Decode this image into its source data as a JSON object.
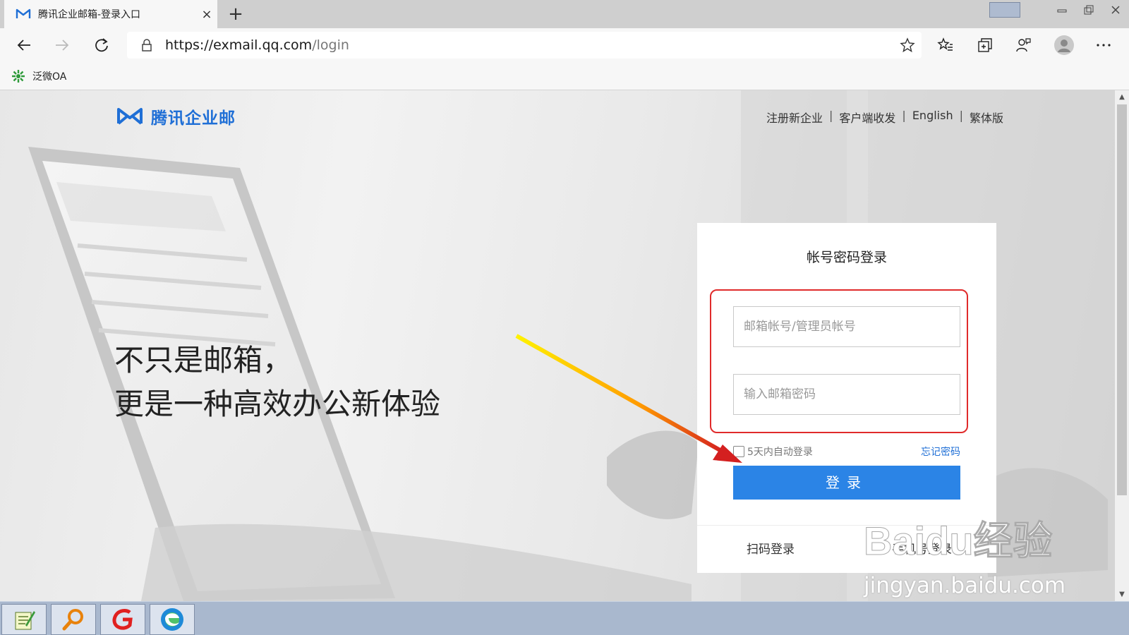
{
  "browser": {
    "tab_title": "腾讯企业邮箱-登录入口",
    "new_tab_label": "+",
    "close_tab_label": "×",
    "url_host": "https://exmail.qq.com",
    "url_path": "/login",
    "bookmark": "泛微OA"
  },
  "page": {
    "brand": "腾讯企业邮",
    "nav": [
      "注册新企业",
      "客户端收发",
      "English",
      "繁体版"
    ],
    "nav_separator": "|",
    "slogan_line1": "不只是邮箱，",
    "slogan_line2": "更是一种高效办公新体验"
  },
  "login": {
    "title": "帐号密码登录",
    "account_placeholder": "邮箱帐号/管理员帐号",
    "password_placeholder": "输入邮箱密码",
    "remember_label": "5天内自动登录",
    "forgot_label": "忘记密码",
    "submit_label": "登录",
    "qr_login": "扫码登录",
    "phone_login": "手机号登录"
  },
  "watermark": {
    "brand": "Baidu经验",
    "url": "jingyan.baidu.com"
  },
  "colors": {
    "accent": "#2b84e6",
    "brand_blue": "#1f6fd6",
    "highlight_red": "#e02b2b",
    "arrow_yellow": "#ffe600",
    "arrow_red": "#d42020"
  },
  "icons": {
    "back": "arrow-left-icon",
    "forward": "arrow-right-icon",
    "refresh": "refresh-icon",
    "lock": "lock-icon",
    "favorite": "star-icon",
    "favorites": "favorites-icon",
    "collections": "collections-icon",
    "feedback": "feedback-icon",
    "profile": "profile-icon",
    "more": "more-icon"
  }
}
